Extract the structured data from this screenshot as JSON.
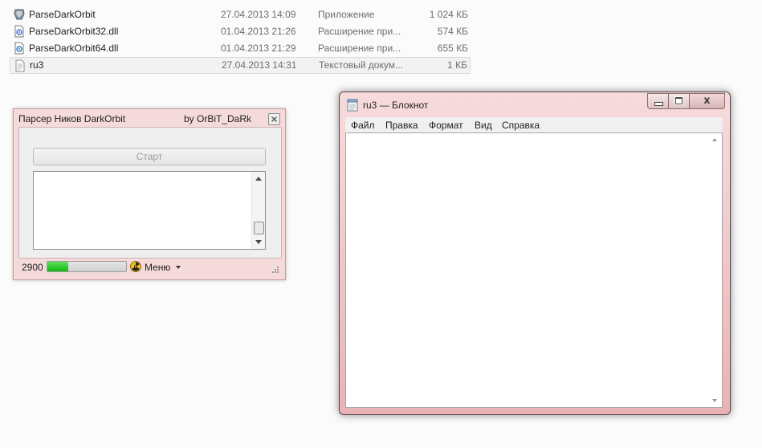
{
  "file_list": {
    "rows": [
      {
        "icon": "application-icon",
        "name": "ParseDarkOrbit",
        "date": "27.04.2013 14:09",
        "type": "Приложение",
        "size": "1 024 КБ",
        "selected": false
      },
      {
        "icon": "dll-file-icon",
        "name": "ParseDarkOrbit32.dll",
        "date": "01.04.2013 21:26",
        "type": "Расширение при...",
        "size": "574 КБ",
        "selected": false
      },
      {
        "icon": "dll-file-icon",
        "name": "ParseDarkOrbit64.dll",
        "date": "01.04.2013 21:29",
        "type": "Расширение при...",
        "size": "655 КБ",
        "selected": false
      },
      {
        "icon": "text-file-icon",
        "name": "ru3",
        "date": "27.04.2013 14:31",
        "type": "Текстовый докум...",
        "size": "1 КБ",
        "selected": true
      }
    ]
  },
  "parser_window": {
    "title": "Парсер Ников DarkOrbit",
    "author": "by OrBiT_DaRk",
    "start_label": "Старт",
    "count": "2900",
    "progress": 0.27,
    "menu_label": "Меню",
    "colors": {
      "progress_fill": "#22c422",
      "frame": "#f5dadb"
    }
  },
  "notepad": {
    "title": "ru3 — Блокнот",
    "menu": [
      "Файл",
      "Правка",
      "Формат",
      "Вид",
      "Справка"
    ],
    "close_glyph": "x",
    "content": ""
  }
}
